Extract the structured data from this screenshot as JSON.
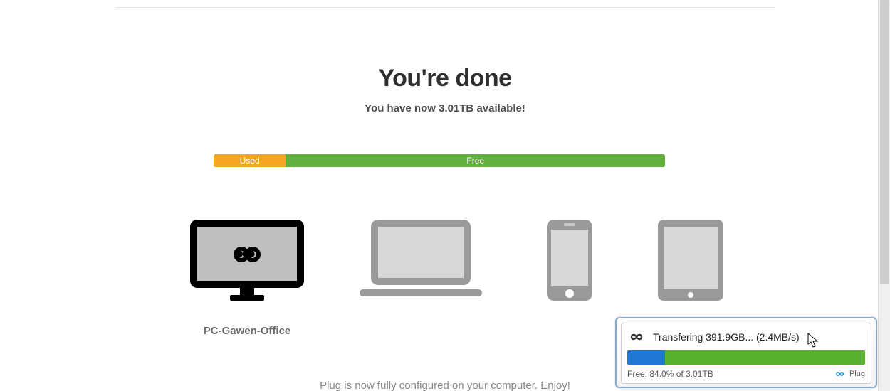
{
  "main": {
    "title": "You're done",
    "subtitle_prefix": "You have now ",
    "subtitle_amount": "3.01TB",
    "subtitle_suffix": " available!",
    "storage": {
      "used_label": "Used",
      "free_label": "Free"
    },
    "devices": [
      {
        "label": "PC-Gawen-Office"
      }
    ],
    "footer": "Plug is now fully configured on your computer. Enjoy!"
  },
  "popup": {
    "status": "Transfering 391.9GB... (2.4MB/s)",
    "free_text": "Free: 84.0% of 3.01TB",
    "brand": "Plug"
  }
}
